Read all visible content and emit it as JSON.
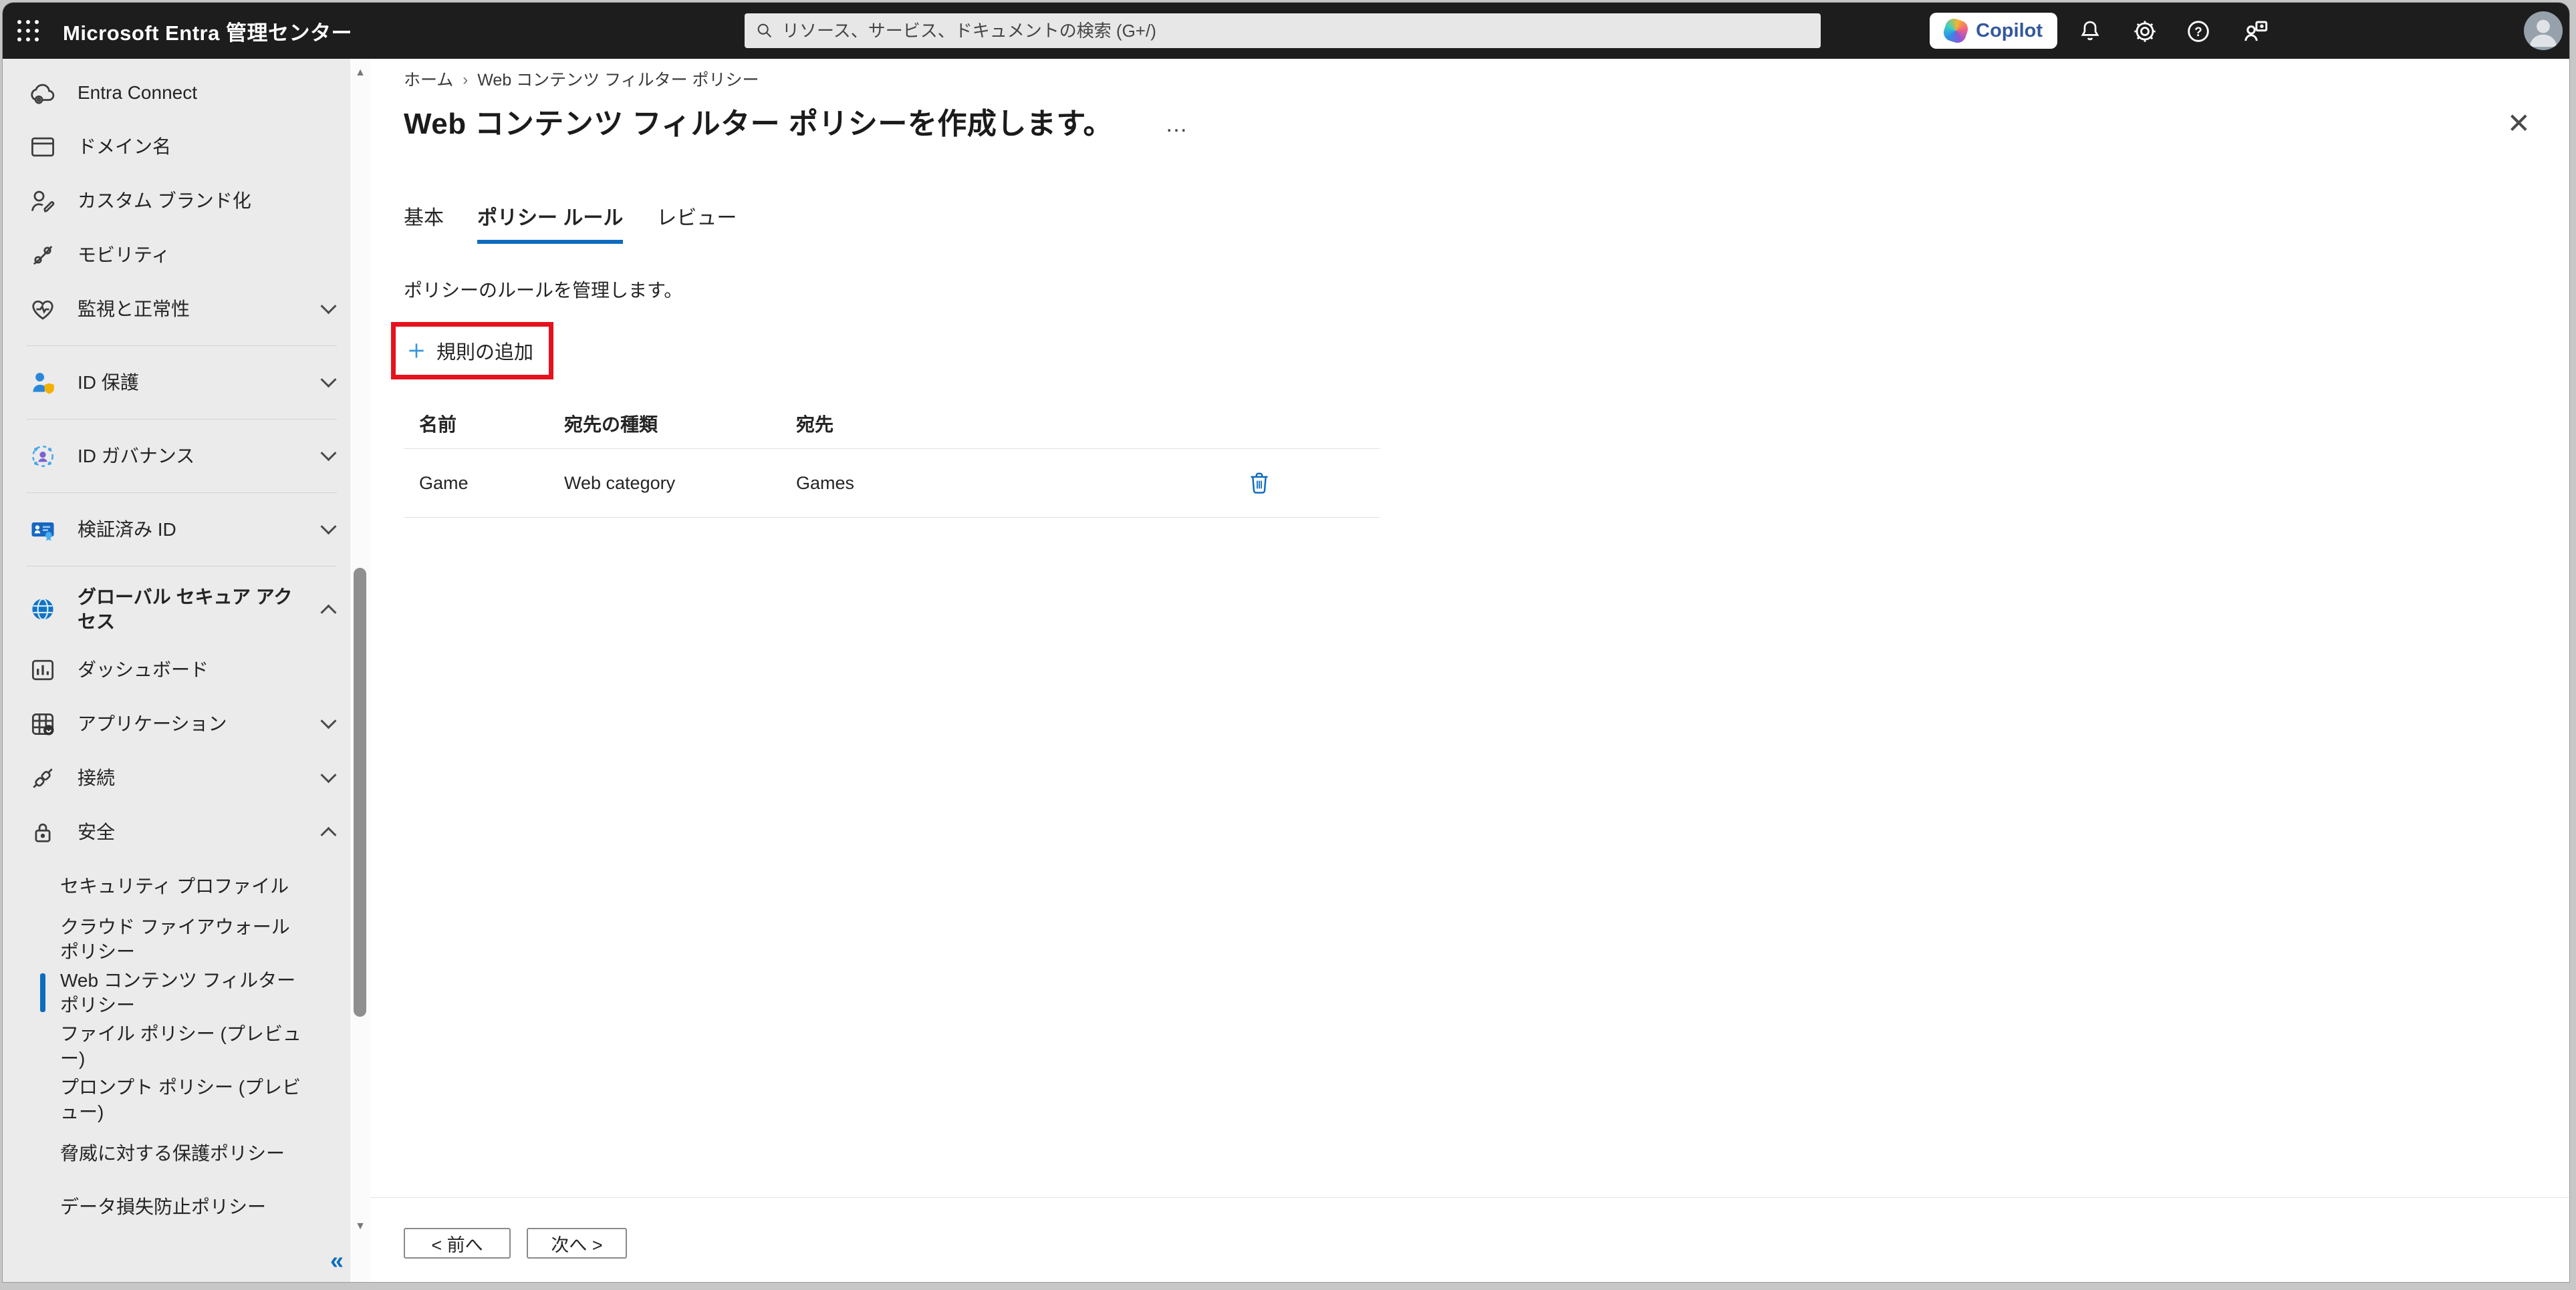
{
  "header": {
    "app_title": "Microsoft Entra 管理センター",
    "search_placeholder": "リソース、サービス、ドキュメントの検索 (G+/)",
    "copilot_label": "Copilot"
  },
  "icons": {
    "breadcrumb_separator": "›",
    "overflow": "…",
    "close": "✕",
    "collapse": "«",
    "scroll_up": "▲",
    "scroll_down": "▼"
  },
  "colors": {
    "accent": "#0f6cbd",
    "highlight_red": "#e5121d",
    "header_bg": "#1d1d1d",
    "sidebar_bg": "#ebebeb"
  },
  "sidebar": {
    "items": [
      {
        "label": "Entra Connect",
        "icon": "cloud-sync-icon"
      },
      {
        "label": "ドメイン名",
        "icon": "domain-icon"
      },
      {
        "label": "カスタム ブランド化",
        "icon": "person-edit-icon"
      },
      {
        "label": "モビリティ",
        "icon": "mobility-icon"
      },
      {
        "label": "監視と正常性",
        "icon": "heart-pulse-icon",
        "chevron": "down"
      },
      {
        "label": "ID 保護",
        "icon": "id-protection-icon",
        "chevron": "down"
      },
      {
        "label": "ID ガバナンス",
        "icon": "id-governance-icon",
        "chevron": "down"
      },
      {
        "label": "検証済み ID",
        "icon": "verified-id-icon",
        "chevron": "down"
      },
      {
        "label": "グローバル セキュア アクセス",
        "icon": "global-secure-access-icon",
        "chevron": "up"
      },
      {
        "label": "ダッシュボード",
        "icon": "dashboard-icon"
      },
      {
        "label": "アプリケーション",
        "icon": "applications-icon",
        "chevron": "down"
      },
      {
        "label": "接続",
        "icon": "plug-icon",
        "chevron": "down"
      },
      {
        "label": "安全",
        "icon": "lock-icon",
        "chevron": "up"
      },
      {
        "label": "セキュリティ プロファイル"
      },
      {
        "label": "クラウド ファイアウォール ポリシー"
      },
      {
        "label": "Web コンテンツ フィルター ポリシー",
        "selected": true
      },
      {
        "label": "ファイル ポリシー (プレビュー)"
      },
      {
        "label": "プロンプト ポリシー (プレビュー)"
      },
      {
        "label": "脅威に対する保護ポリシー"
      },
      {
        "label": "データ損失防止ポリシー"
      }
    ]
  },
  "main": {
    "breadcrumb": {
      "home": "ホーム",
      "current": "Web コンテンツ フィルター ポリシー"
    },
    "title": "Web コンテンツ フィルター ポリシーを作成します。",
    "tabs": [
      {
        "label": "基本"
      },
      {
        "label": "ポリシー ルール",
        "active": true
      },
      {
        "label": "レビュー"
      }
    ],
    "description": "ポリシーのルールを管理します。",
    "add_rule_label": "規則の追加",
    "table": {
      "columns": [
        "名前",
        "宛先の種類",
        "宛先"
      ],
      "rows": [
        {
          "name": "Game",
          "dest_type": "Web category",
          "dest": "Games"
        }
      ]
    },
    "footer": {
      "prev_label": "< 前へ",
      "next_label": "次へ >"
    }
  }
}
